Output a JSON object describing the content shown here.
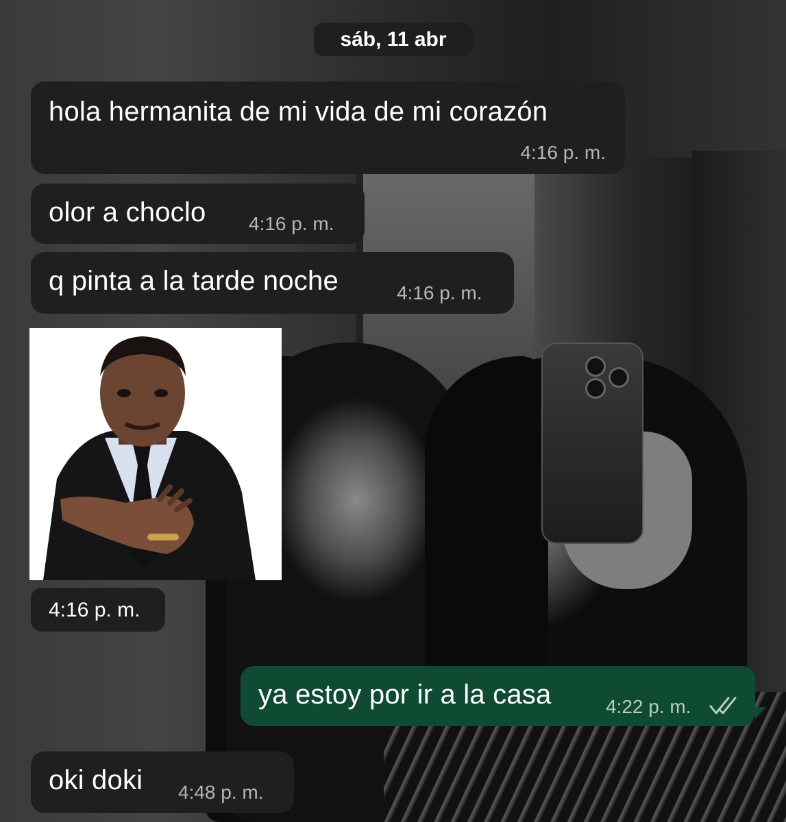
{
  "chat": {
    "date_label": "sáb, 11 abr",
    "messages": [
      {
        "text": "hola hermanita de mi vida de mi corazón",
        "time": "4:16 p. m."
      },
      {
        "text": "olor a choclo",
        "time": "4:16 p. m."
      },
      {
        "text": "q pinta a la tarde noche",
        "time": "4:16 p. m."
      },
      {
        "sticker": "man-offering-hand-sticker",
        "time": "4:16 p. m."
      },
      {
        "text": "ya estoy por ir a la casa",
        "time": "4:22 p. m.",
        "outgoing": true,
        "status_icon": "double-check-icon"
      },
      {
        "text": "oki doki",
        "time": "4:48 p. m."
      }
    ]
  },
  "colors": {
    "incoming_bubble": "#1f1f1f",
    "outgoing_bubble": "#0f4a33",
    "text": "#ffffff",
    "timestamp": "#b7b7b7"
  }
}
